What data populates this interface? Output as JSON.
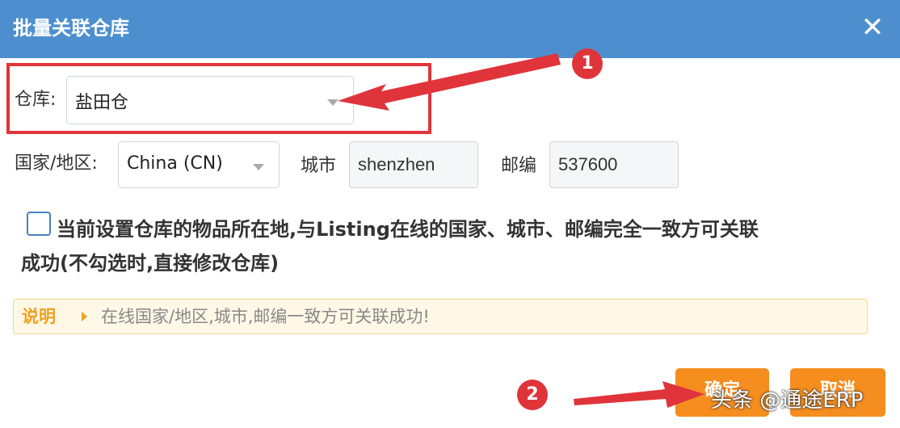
{
  "dialog": {
    "title": "批量关联仓库",
    "close_icon": "close-icon"
  },
  "warehouse": {
    "label": "仓库:",
    "value": "盐田仓"
  },
  "country": {
    "label": "国家/地区:",
    "value": "China (CN)"
  },
  "city": {
    "label": "城市",
    "value": "shenzhen"
  },
  "postcode": {
    "label": "邮编",
    "value": "537600"
  },
  "checkbox": {
    "checked": false,
    "text_line1": "当前设置仓库的物品所在地,与Listing在线的国家、城市、邮编完全一致方可关联",
    "text_line2": "成功(不勾选时,直接修改仓库)"
  },
  "notice": {
    "title": "说明",
    "text": "在线国家/地区,城市,邮编一致方可关联成功!"
  },
  "buttons": {
    "confirm": "确定",
    "cancel": "取消"
  },
  "annotations": {
    "badge1": "1",
    "badge2": "2",
    "color": "#e0343b"
  },
  "watermark": "头条 @通途ERP"
}
